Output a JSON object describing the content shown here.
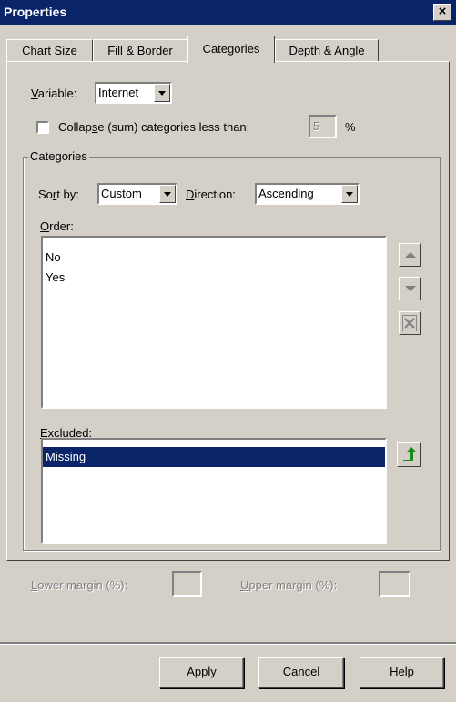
{
  "window": {
    "title": "Properties",
    "close_glyph": "×"
  },
  "tabs": [
    {
      "label": "Chart Size",
      "active": false
    },
    {
      "label": "Fill & Border",
      "active": false
    },
    {
      "label": "Categories",
      "active": true
    },
    {
      "label": "Depth & Angle",
      "active": false
    }
  ],
  "variable": {
    "label_prefix": "V",
    "label_rest": "ariable:",
    "value": "Internet"
  },
  "collapse": {
    "checked": false,
    "label_a": "Collap",
    "label_u": "s",
    "label_b": "e (sum) categories less than:",
    "value": "5",
    "unit": "%"
  },
  "categories_group": {
    "title": "Categories",
    "sort_label_a": "So",
    "sort_label_u": "r",
    "sort_label_b": "t by:",
    "sort_value": "Custom",
    "direction_label_u": "D",
    "direction_label_b": "irection:",
    "direction_value": "Ascending",
    "order_label_u": "O",
    "order_label_b": "rder:",
    "order_items": [
      "No",
      "Yes"
    ],
    "excluded_label_u": "E",
    "excluded_label_b": "xcluded:",
    "excluded_items": [
      "Missing"
    ],
    "icons": {
      "move_up": "triangle-up-icon",
      "move_down": "triangle-down-icon",
      "exclude": "x-icon",
      "restore": "green-arrow-up-icon"
    }
  },
  "margins": {
    "lower_u": "L",
    "lower_b": "ower margin (%):",
    "upper_u": "U",
    "upper_b": "pper margin (%):"
  },
  "buttons": {
    "apply_u": "A",
    "apply_b": "pply",
    "cancel_u": "C",
    "cancel_b": "ancel",
    "help_u": "H",
    "help_b": "elp"
  },
  "colors": {
    "title_bar": "#0a246a",
    "selection": "#0a246a",
    "face": "#d4d0c8",
    "arrow_green": "#1a8a1a"
  }
}
